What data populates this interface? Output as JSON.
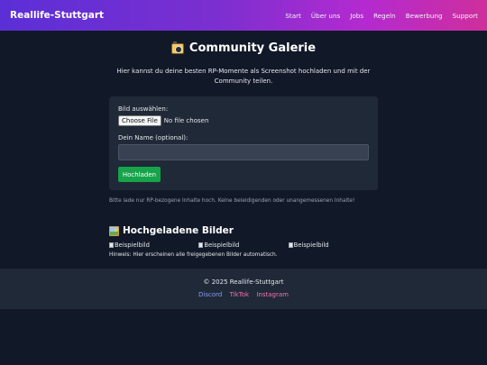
{
  "header": {
    "brand": "Reallife-Stuttgart",
    "nav": [
      "Start",
      "Über uns",
      "Jobs",
      "Regeln",
      "Bewerbung",
      "Support"
    ]
  },
  "page": {
    "title": "Community Galerie",
    "title_icon": "camera-icon",
    "intro": "Hier kannst du deine besten RP-Momente als Screenshot hochladen und mit der Community teilen."
  },
  "upload_form": {
    "file_label": "Bild auswählen:",
    "file_button": "Choose File",
    "file_status": "No file chosen",
    "name_label": "Dein Name (optional):",
    "name_value": "",
    "name_placeholder": "",
    "submit_label": "Hochladen",
    "submit_color": "#16a34a"
  },
  "notice": "Bitte lade nur RP-bezogene Inhalte hoch. Keine beleidigenden oder unangemessenen Inhalte!",
  "gallery": {
    "title": "Hochgeladene Bilder",
    "title_icon": "picture-icon",
    "images": [
      "Beispielbild",
      "Beispielbild",
      "Beispielbild"
    ],
    "hint": "Hinweis: Hier erscheinen alle freigegebenen Bilder automatisch."
  },
  "footer": {
    "copyright": "© 2025 Reallife-Stuttgart",
    "links": [
      "Discord",
      "TikTok",
      "Instagram"
    ]
  },
  "colors": {
    "background": "#111827",
    "card": "#1f2937",
    "header_gradient_start": "#5b2fd6",
    "header_gradient_end": "#cf2f9c",
    "discord": "#8b9bf5",
    "tiktok": "#f472b6",
    "instagram": "#f472b6"
  }
}
